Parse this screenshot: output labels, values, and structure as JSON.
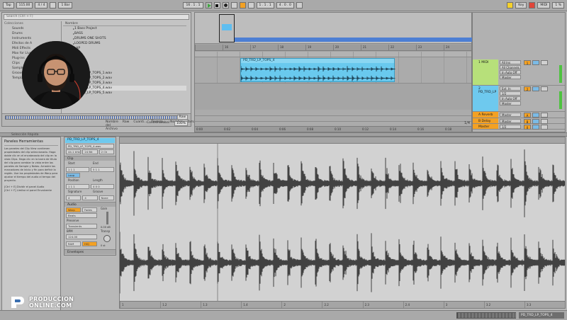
{
  "colors": {
    "accent": "#f3a124",
    "clip": "#69c9ee",
    "track_midi": "#b7e07a",
    "track_audio": "#6ec9ee",
    "return_a": "#f3a124",
    "master": "#f3a124",
    "meter": "#4ec240",
    "overview_bar": "#4d7fd4"
  },
  "topbar": {
    "tap": "Tap",
    "tempo": "115.00",
    "signature": "4 / 4",
    "quantize": "1 Bar",
    "position": "16 . 1 . 1",
    "loop_start": "1 . 1 . 1",
    "loop_length": "4 . 0 . 0",
    "key": "Key",
    "midi": "MIDI",
    "cpu": "1 %"
  },
  "browser": {
    "search_placeholder": "Search (Ctrl + F)",
    "categories_header": "Colecciones",
    "categories": [
      "Sounds",
      "Drums",
      "Instruments",
      "Efectos de A",
      "Midi Effects",
      "Max for Live",
      "Plug-ins",
      "Clips",
      "Samples",
      "Grooves",
      "Templates"
    ],
    "files_header": "Nombre",
    "files": [
      "1 Bass Project",
      "BASS",
      "DRUMS ONE SHOTS",
      "LOOPED DRUMS",
      "...AP",
      "...",
      "...",
      "...",
      "...",
      "PD_TRD_LP_TOPS_1.wav",
      "PD_TRD_LP_TOPS_2.wav",
      "PD_TRD_LP_TOPS_3.wav",
      "PD_TRD_LP_TOPS_4.wav",
      "PD_TRD_LP_TOPS_5.wav"
    ],
    "columns": [
      "Nombre del Archivo",
      "Raw",
      "Cuanti...",
      "Tiempo...",
      "Nombre",
      "Tamaño"
    ],
    "raw_label": "Raw",
    "control_label": "Control Global",
    "control_value": "100%"
  },
  "arrangement": {
    "ruler": [
      "",
      "16",
      "17",
      "18",
      "19",
      "20",
      "21",
      "22",
      "23",
      "24"
    ],
    "time_ruler": [
      "0:00",
      "0:02",
      "0:04",
      "0:06",
      "0:08",
      "0:10",
      "0:12",
      "0:14",
      "0:16",
      "0:18"
    ],
    "clip_name": "PD_TRD_LP_TOPS_4",
    "scroll_label": "1/4"
  },
  "mixer": {
    "tracks": [
      {
        "name": "1 MIDI",
        "in": "All Ins",
        "ch": "All Channels",
        "monitor": "In Auto Off",
        "out": "Master",
        "num": "1"
      },
      {
        "name": "2 PD_TRD_LP",
        "in": "Ext. In",
        "ch": "1/2",
        "monitor": "In Auto Off",
        "out": "Master",
        "num": "2"
      },
      {
        "name": "A Reverb",
        "out": "Master",
        "num": "A"
      },
      {
        "name": "B Delay",
        "out": "Master",
        "num": "B"
      },
      {
        "name": "Master",
        "out": "1/2",
        "num": "0"
      }
    ]
  },
  "infobar": {
    "text": "Selección Rápida"
  },
  "help": {
    "title": "Paneles Herramientas",
    "body": "Los paneles del Clip View contienen propiedades del clip seleccionado. Haga doble clic en el encabezado del clip en la vista Clips. Haga clic en la barra de título del clip para cambiar la vista entre los paneles de Sample y Notas. Arrastre los marcadores de inicio y fin para definir la región. Use las propiedades de Warp para ajustar el tiempo del audio al tempo del proyecto.",
    "shortcut1": "[Ctrl + E] Dividir el panel Audio",
    "shortcut2": "[Ctrl + F] Limitar el panel Envolvente"
  },
  "clipview": {
    "clip_name": "PD_TRD_LP_TOPS_4",
    "file_name": "PD_TRD_LP_TOPS_4.wav",
    "sample_rate": "44.1 kHz",
    "bit_depth": "24 Bit",
    "channels": "2 Ch",
    "clip_section": "Clip",
    "start_label": "Start",
    "start_value": "1 1 1",
    "end_label": "End",
    "end_value": "5 1 1",
    "loop_label": "Loop",
    "position_label": "Position",
    "length_label": "Length",
    "length_value": "4 0 0",
    "signature_label": "Signature",
    "groove_label": "Groove",
    "sig_num": "4",
    "sig_den": "4",
    "groove_value": "None",
    "audio_section": "Audio",
    "warp_label": "Warp",
    "fade_label": "Fades",
    "warp_mode": "Beats",
    "preserve_label": "Preserve",
    "preserve_value": "Transients",
    "bpm_label": "BPM",
    "bpm_value": "124.00",
    "gain_label": "Gain",
    "gain_value": "0.00 dB",
    "transpose_label": "Transp",
    "transpose_value": "0 st",
    "ram_label": "RAM",
    "hiq_label": "HiQ",
    "envelopes_section": "Envelopes"
  },
  "sample_editor": {
    "ruler": [
      "1",
      "1.2",
      "1.3",
      "1.4",
      "2",
      "2.2",
      "2.3",
      "2.4",
      "3",
      "3.2",
      "3.3"
    ]
  },
  "statusbar": {
    "clip": "PD_TRD_LP_TOPS_4"
  },
  "logo": {
    "line1": "PRODUCCION",
    "line2": "ONLINE.COM"
  }
}
